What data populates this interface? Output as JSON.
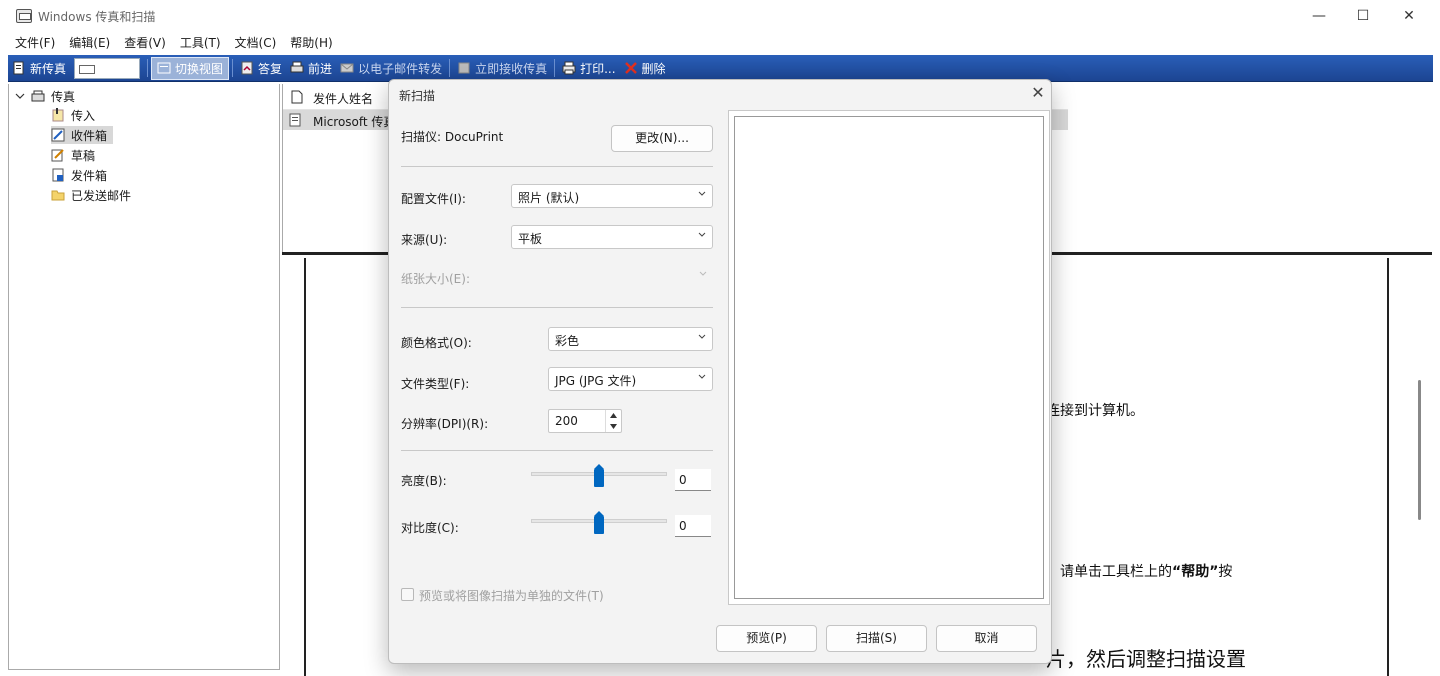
{
  "window": {
    "title": "Windows 传真和扫描",
    "minimize": "—",
    "maximize": "☐",
    "close": "✕"
  },
  "menu": [
    "文件(F)",
    "编辑(E)",
    "查看(V)",
    "工具(T)",
    "文档(C)",
    "帮助(H)"
  ],
  "toolbar": {
    "new_fax": "新传真",
    "switch_view": "切换视图",
    "reply": "答复",
    "forward": "前进",
    "forward_email": "以电子邮件转发",
    "receive_now": "立即接收传真",
    "print": "打印...",
    "delete": "删除"
  },
  "tree": {
    "root": "传真",
    "items": [
      "传入",
      "收件箱",
      "草稿",
      "发件箱",
      "已发送邮件"
    ],
    "selected_index": 1
  },
  "list": {
    "header": "发件人姓名",
    "row": "Microsoft 传真"
  },
  "preview": {
    "text1": "连接到计算机。",
    "text2_prefix": "，请单击工具栏上的",
    "text2_bold": "“帮助”",
    "text2_suffix": "按",
    "text3": "片，然后调整扫描设置"
  },
  "dialog": {
    "title": "新扫描",
    "scanner_label": "扫描仪: DocuPrint",
    "change_button": "更改(N)...",
    "profile_label": "配置文件(I):",
    "profile_value": "照片 (默认)",
    "source_label": "来源(U):",
    "source_value": "平板",
    "paper_size_label": "纸张大小(E):",
    "color_format_label": "颜色格式(O):",
    "color_format_value": "彩色",
    "file_type_label": "文件类型(F):",
    "file_type_value": "JPG (JPG 文件)",
    "resolution_label": "分辨率(DPI)(R):",
    "resolution_value": "200",
    "brightness_label": "亮度(B):",
    "brightness_value": "0",
    "contrast_label": "对比度(C):",
    "contrast_value": "0",
    "separate_files_label": "预览或将图像扫描为单独的文件(T)",
    "preview_button": "预览(P)",
    "scan_button": "扫描(S)",
    "cancel_button": "取消"
  },
  "colors": {
    "toolbar": "#1c4592",
    "slider_thumb": "#0067c0"
  }
}
